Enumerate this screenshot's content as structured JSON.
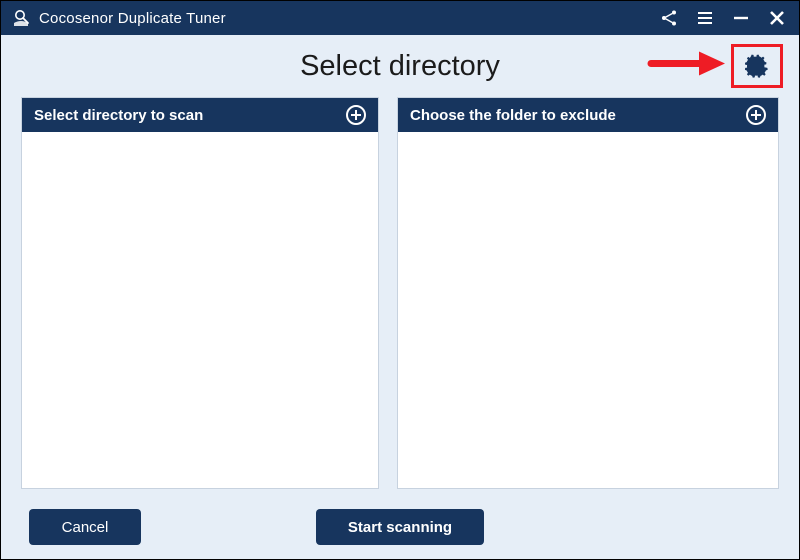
{
  "titlebar": {
    "app_name": "Cocosenor Duplicate Tuner"
  },
  "header": {
    "page_title": "Select directory"
  },
  "panels": {
    "scan": {
      "title": "Select directory to scan"
    },
    "exclude": {
      "title": "Choose the folder to exclude"
    }
  },
  "footer": {
    "cancel_label": "Cancel",
    "start_label": "Start scanning"
  },
  "colors": {
    "brand": "#17355e",
    "highlight": "#ee1c25",
    "background": "#e6eef7"
  }
}
